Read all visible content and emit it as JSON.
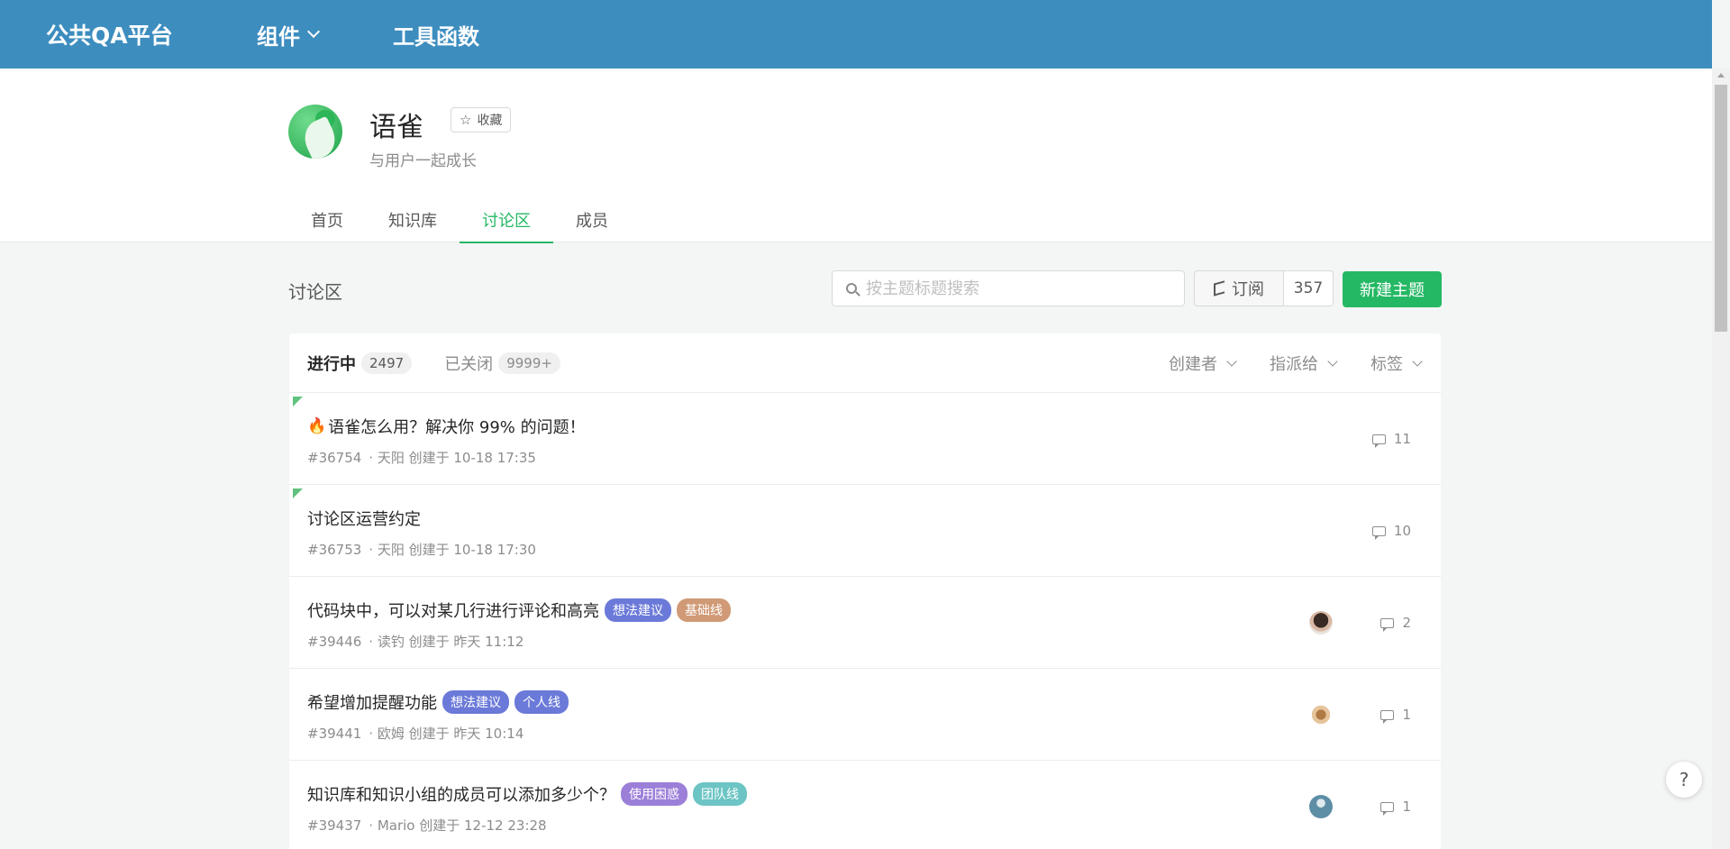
{
  "topbar": {
    "brand": "公共QA平台",
    "nav": [
      {
        "label": "组件",
        "has_dropdown": true
      },
      {
        "label": "工具函数",
        "has_dropdown": false
      }
    ],
    "color": "#3d8dbf"
  },
  "team": {
    "name": "语雀",
    "favorite_label": "收藏",
    "description": "与用户一起成长",
    "tabs": [
      "首页",
      "知识库",
      "讨论区",
      "成员"
    ],
    "active_tab": "讨论区"
  },
  "toolbar": {
    "section_title": "讨论区",
    "search_placeholder": "按主题标题搜索",
    "subscribe_label": "订阅",
    "subscribe_count": "357",
    "new_topic_label": "新建主题",
    "accent": "#25b864"
  },
  "list": {
    "states": [
      {
        "label": "进行中",
        "count": "2497",
        "active": true
      },
      {
        "label": "已关闭",
        "count": "9999+",
        "active": false
      }
    ],
    "filters": [
      "创建者",
      "指派给",
      "标签"
    ],
    "rows": [
      {
        "pinned": true,
        "emoji": "🔥",
        "title": "语雀怎么用？解决你 99% 的问题！",
        "labels": [],
        "number": "#36754",
        "meta": "· 天阳 创建于 10-18 17:35",
        "avatar": null,
        "comments": "11"
      },
      {
        "pinned": true,
        "emoji": "",
        "title": "讨论区运营约定",
        "labels": [],
        "number": "#36753",
        "meta": "· 天阳 创建于 10-18 17:30",
        "avatar": null,
        "comments": "10"
      },
      {
        "pinned": false,
        "emoji": "",
        "title": "代码块中，可以对某几行进行评论和高亮",
        "labels": [
          {
            "text": "想法建议",
            "color": "#6b7ad8"
          },
          {
            "text": "基础线",
            "color": "#d09a76"
          }
        ],
        "number": "#39446",
        "meta": "· 读钓 创建于 昨天 11:12",
        "avatar": "avatar-woman",
        "comments": "2"
      },
      {
        "pinned": false,
        "emoji": "",
        "title": "希望增加提醒功能",
        "labels": [
          {
            "text": "想法建议",
            "color": "#6b7ad8"
          },
          {
            "text": "个人线",
            "color": "#6b7ad8"
          }
        ],
        "number": "#39441",
        "meta": "· 欧姆 创建于 昨天 10:14",
        "avatar": "avatar-owl",
        "comments": "1"
      },
      {
        "pinned": false,
        "emoji": "",
        "title": "知识库和知识小组的成员可以添加多少个？",
        "labels": [
          {
            "text": "使用困惑",
            "color": "#9b7fd8"
          },
          {
            "text": "团队线",
            "color": "#6cc4c4"
          }
        ],
        "number": "#39437",
        "meta": "· Mario 创建于 12-12 23:28",
        "avatar": "avatar-blue",
        "comments": "1"
      }
    ]
  },
  "help_label": "?"
}
